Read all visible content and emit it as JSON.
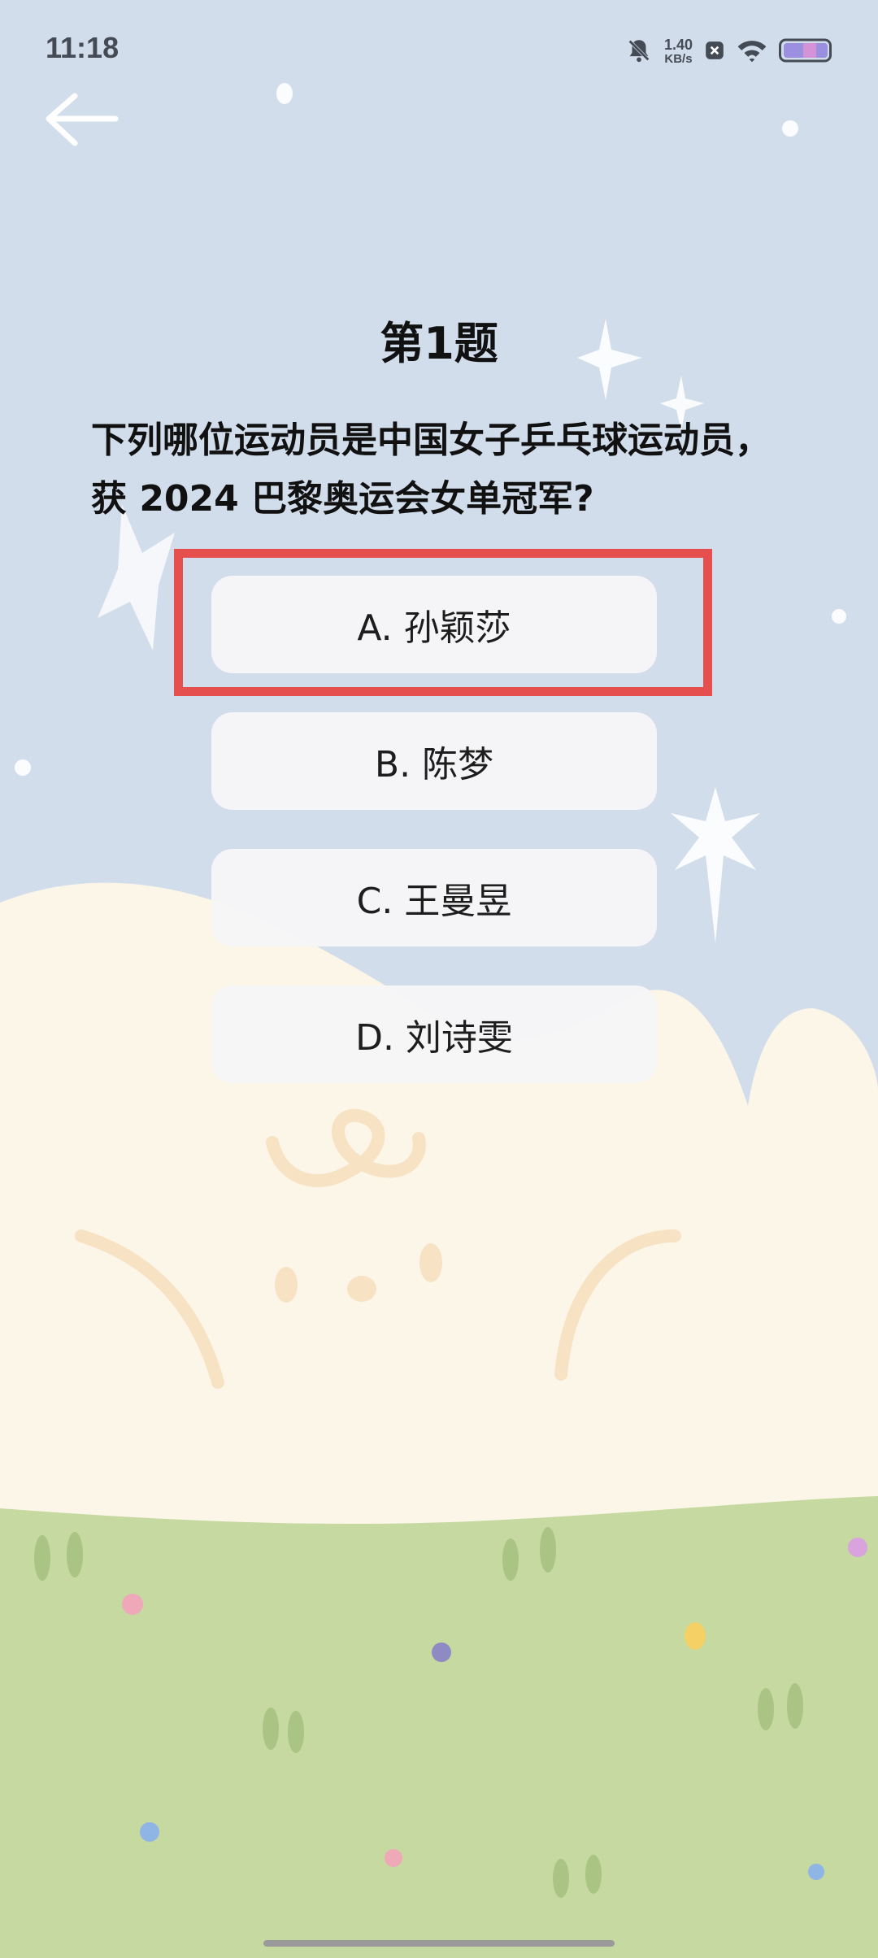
{
  "status_bar": {
    "time": "11:18",
    "speed_value": "1.40",
    "speed_unit": "KB/s",
    "icons": [
      "bell-muted-icon",
      "close-box-icon",
      "wifi-icon",
      "battery-icon"
    ]
  },
  "nav": {
    "back_icon": "arrow-left-icon"
  },
  "quiz": {
    "title": "第1题",
    "question": "下列哪位运动员是中国女子乒乓球运动员，获 2024 巴黎奥运会女单冠军?",
    "options": [
      {
        "label": "A. 孙颖莎"
      },
      {
        "label": "B. 陈梦"
      },
      {
        "label": "C. 王曼昱"
      },
      {
        "label": "D. 刘诗雯"
      }
    ]
  },
  "colors": {
    "sky": "#d2ddec",
    "hill": "#fcf6e9",
    "grass": "#c5d9a1",
    "highlight": "#e5504f",
    "option_bg": "#f6f6f7"
  }
}
